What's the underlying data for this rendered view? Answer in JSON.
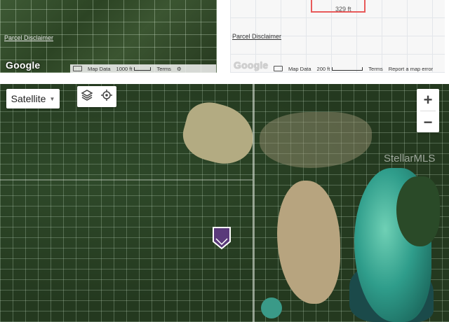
{
  "top_left_map": {
    "disclaimer": "Parcel Disclaimer",
    "google_logo": "Google",
    "attribution": {
      "map_data": "Map Data",
      "scale": "1000 ft",
      "terms": "Terms"
    },
    "keyboard_icon": "keyboard-icon",
    "settings_icon": "gear-icon"
  },
  "top_right_map": {
    "parcel_dimension": "329 ft",
    "disclaimer": "Parcel Disclaimer",
    "google_logo": "Google",
    "attribution": {
      "map_data": "Map Data",
      "scale": "200 ft",
      "terms": "Terms",
      "report": "Report a map error"
    },
    "keyboard_icon": "keyboard-icon"
  },
  "main_map": {
    "map_type_label": "Satellite",
    "layers_icon": "layers-icon",
    "locate_icon": "target-icon",
    "zoom_in": "+",
    "zoom_out": "−",
    "watermark": "StellarMLS",
    "marker_icon": "property-marker-icon",
    "colors": {
      "marker": "#5a3a7a",
      "parcel_outline": "#e85a5a"
    }
  }
}
